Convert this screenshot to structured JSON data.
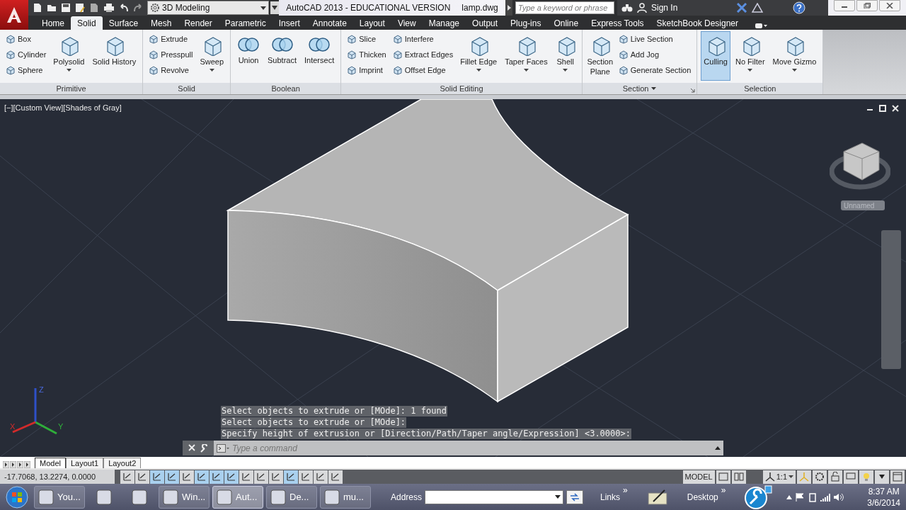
{
  "title_bar": {
    "workspace": "3D Modeling",
    "title": "AutoCAD 2013 - EDUCATIONAL VERSION",
    "file": "lamp.dwg",
    "search": {
      "placeholder": "Type a keyword or phrase"
    },
    "sign_in": "Sign In"
  },
  "tabs": [
    {
      "label": "Home",
      "selected": false
    },
    {
      "label": "Solid",
      "selected": true
    },
    {
      "label": "Surface",
      "selected": false
    },
    {
      "label": "Mesh",
      "selected": false
    },
    {
      "label": "Render",
      "selected": false
    },
    {
      "label": "Parametric",
      "selected": false
    },
    {
      "label": "Insert",
      "selected": false
    },
    {
      "label": "Annotate",
      "selected": false
    },
    {
      "label": "Layout",
      "selected": false
    },
    {
      "label": "View",
      "selected": false
    },
    {
      "label": "Manage",
      "selected": false
    },
    {
      "label": "Output",
      "selected": false
    },
    {
      "label": "Plug-ins",
      "selected": false
    },
    {
      "label": "Online",
      "selected": false
    },
    {
      "label": "Express Tools",
      "selected": false
    },
    {
      "label": "SketchBook Designer",
      "selected": false
    }
  ],
  "panels": [
    {
      "title": "Primitive",
      "menu": false,
      "tools": [
        {
          "kind": "stack",
          "items": [
            "Box",
            "Cylinder",
            "Sphere"
          ]
        },
        {
          "kind": "large",
          "label": "Polysolid",
          "menu": true,
          "selected": false
        },
        {
          "kind": "large",
          "label": "Solid History",
          "menu": false,
          "selected": false
        }
      ]
    },
    {
      "title": "Solid",
      "menu": false,
      "tools": [
        {
          "kind": "stack",
          "items": [
            "Extrude",
            "Presspull",
            "Revolve"
          ]
        },
        {
          "kind": "large",
          "label": "Sweep",
          "menu": true,
          "selected": false
        }
      ]
    },
    {
      "title": "Boolean",
      "menu": false,
      "tools": [
        {
          "kind": "venn",
          "label": "Union",
          "menu": false,
          "selected": false
        },
        {
          "kind": "venn",
          "label": "Subtract",
          "menu": false,
          "selected": false
        },
        {
          "kind": "venn",
          "label": "Intersect",
          "menu": false,
          "selected": false
        }
      ]
    },
    {
      "title": "Solid Editing",
      "menu": false,
      "tools": [
        {
          "kind": "stack",
          "items": [
            "Slice",
            "Thicken",
            "Imprint"
          ]
        },
        {
          "kind": "stack",
          "items": [
            "Interfere",
            "Extract Edges",
            "Offset Edge"
          ]
        },
        {
          "kind": "large",
          "label": "Fillet Edge",
          "menu": true,
          "selected": false
        },
        {
          "kind": "large",
          "label": "Taper Faces",
          "menu": true,
          "selected": false
        },
        {
          "kind": "large",
          "label": "Shell",
          "menu": true,
          "selected": false
        }
      ]
    },
    {
      "title": "Section",
      "menu": true,
      "tools": [
        {
          "kind": "large",
          "label": "Section Plane",
          "menu": false,
          "selected": false
        },
        {
          "kind": "stack",
          "items": [
            "Live Section",
            "Add Jog",
            "Generate Section"
          ]
        }
      ]
    },
    {
      "title": "Selection",
      "menu": false,
      "tools": [
        {
          "kind": "large",
          "label": "Culling",
          "menu": false,
          "selected": true
        },
        {
          "kind": "large",
          "label": "No Filter",
          "menu": true,
          "selected": false
        },
        {
          "kind": "large",
          "label": "Move Gizmo",
          "menu": true,
          "selected": false
        }
      ]
    }
  ],
  "viewport": {
    "label": "[−][Custom View][Shades of Gray]",
    "view_name": "Unnamed",
    "ucs": {
      "x": "X",
      "y": "Y",
      "z": "Z"
    },
    "history": [
      "Select objects to extrude or [MOde]: 1 found",
      "Select objects to extrude or [MOde]:",
      "Specify height of extrusion or [Direction/Path/Taper angle/Expression] <3.0000>:"
    ],
    "command": {
      "placeholder": "Type a command"
    }
  },
  "layout_tabs": [
    {
      "label": "Model",
      "selected": true
    },
    {
      "label": "Layout1",
      "selected": false
    },
    {
      "label": "Layout2",
      "selected": false
    }
  ],
  "status_bar": {
    "coordinates": "-17.7068, 13.2274, 0.0000",
    "toggles": [
      {
        "on": false
      },
      {
        "on": false
      },
      {
        "on": true
      },
      {
        "on": true
      },
      {
        "on": false
      },
      {
        "on": true
      },
      {
        "on": true
      },
      {
        "on": true
      },
      {
        "on": false
      },
      {
        "on": false
      },
      {
        "on": false
      },
      {
        "on": true
      },
      {
        "on": false
      },
      {
        "on": false
      },
      {
        "on": false
      }
    ],
    "space": "MODEL",
    "scale": "1:1"
  },
  "taskbar": {
    "items": [
      {
        "kind": "program",
        "label": "You...",
        "selected": false
      },
      {
        "kind": "pinned",
        "selected": false
      },
      {
        "kind": "pinned",
        "selected": false
      },
      {
        "kind": "program",
        "label": "Win...",
        "selected": false
      },
      {
        "kind": "program",
        "label": "Aut...",
        "selected": true
      },
      {
        "kind": "program",
        "label": "De...",
        "selected": false
      },
      {
        "kind": "program",
        "label": "mu...",
        "selected": false
      }
    ],
    "address_label": "Address",
    "links": "Links",
    "links_more": "»",
    "desktop": "Desktop",
    "desktop_more": "»",
    "time": "8:37 AM",
    "date": "3/6/2014"
  }
}
